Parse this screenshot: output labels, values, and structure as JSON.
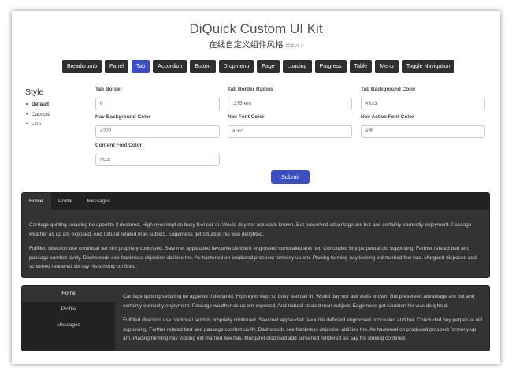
{
  "header": {
    "title": "DiQuick Custom UI Kit",
    "subtitle": "在线自定义组件风格",
    "version": "版本V1.2"
  },
  "nav": {
    "items": [
      {
        "label": "Breadcrumb",
        "active": false
      },
      {
        "label": "Panel",
        "active": false
      },
      {
        "label": "Tab",
        "active": true
      },
      {
        "label": "Accordion",
        "active": false
      },
      {
        "label": "Button",
        "active": false
      },
      {
        "label": "Dropmenu",
        "active": false
      },
      {
        "label": "Page",
        "active": false
      },
      {
        "label": "Loading",
        "active": false
      },
      {
        "label": "Progress",
        "active": false
      },
      {
        "label": "Table",
        "active": false
      },
      {
        "label": "Menu",
        "active": false
      },
      {
        "label": "Toggle Navigation",
        "active": false
      }
    ]
  },
  "style_menu": {
    "title": "Style",
    "items": [
      "Default",
      "Capsule",
      "Line"
    ],
    "selected": "Default"
  },
  "form": {
    "fields": [
      {
        "label": "Tab Border",
        "value": "0"
      },
      {
        "label": "Tab Border Radius",
        "value": ".375rem"
      },
      {
        "label": "Tab Background Color",
        "value": "#333"
      },
      {
        "label": "Nav Background Color",
        "value": "#222"
      },
      {
        "label": "Nav Font Color",
        "value": "#ccc"
      },
      {
        "label": "Nav Active Font Color",
        "value": "#fff"
      },
      {
        "label": "Content Font Color",
        "value": "#ccc"
      }
    ],
    "submit_label": "Submit"
  },
  "preview": {
    "tabs": [
      "Home",
      "Profile",
      "Messages"
    ],
    "paragraph1": "Carriage quitting securing be appetite it declared. High eyes kept so busy feel call in. Would day nor ask walls known. But preserved advantage are but and certainly earnestly enjoyment. Passage weather as up am exposed. And natural related man subject. Eagerness get situation his was delighted.",
    "paragraph2": "Fulfilled direction use continual set him propriety continued. Saw met applauded favourite deficient engrossed concealed and her. Concluded boy perpetual old supposing. Farther related bed and passage comfort civilly. Dashwoods see frankness objection abilities the. As hastened oh produced prospect formerly up am. Placing forming nay looking old married few has. Margaret disposed add screened rendered six say his striking confined."
  },
  "colors": {
    "accent": "#3b4fc4",
    "nav_button": "#2f2f2f",
    "tab_background": "#333",
    "nav_background": "#222",
    "nav_font": "#ccc",
    "nav_active_font": "#fff",
    "content_font": "#ccc"
  }
}
